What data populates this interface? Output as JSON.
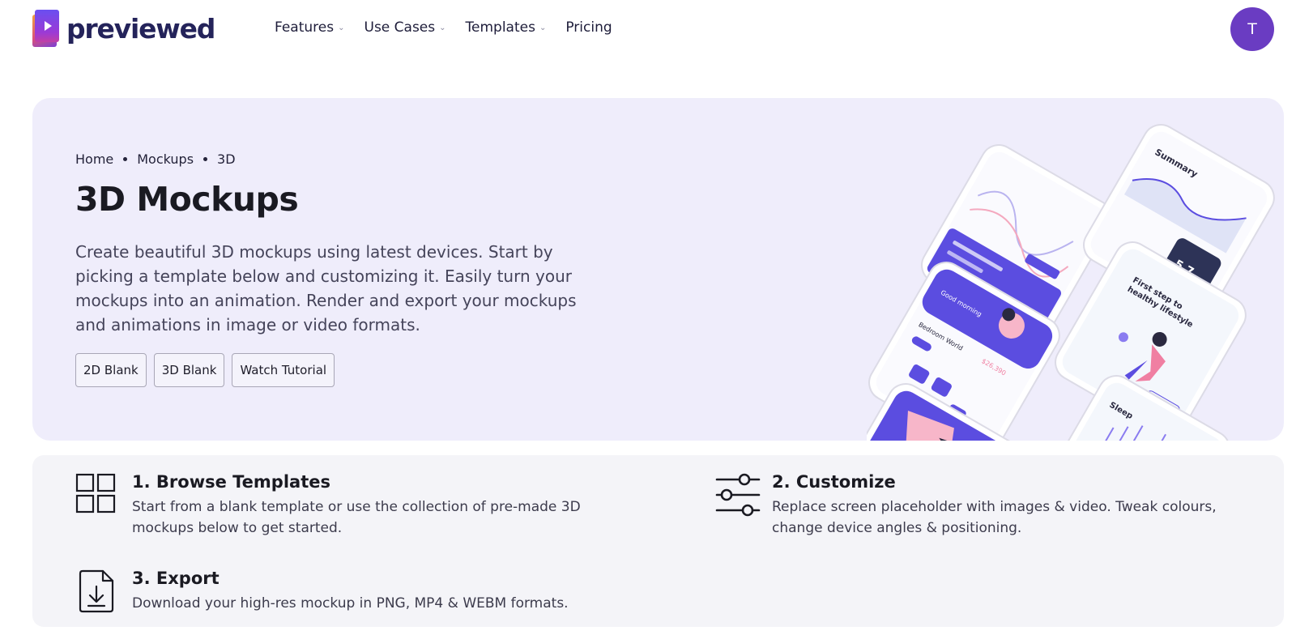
{
  "nav": {
    "logo_text": "previewed",
    "menu": [
      {
        "label": "Features",
        "has_dropdown": true
      },
      {
        "label": "Use Cases",
        "has_dropdown": true
      },
      {
        "label": "Templates",
        "has_dropdown": true
      },
      {
        "label": "Pricing",
        "has_dropdown": false
      }
    ],
    "avatar_initial": "T"
  },
  "hero": {
    "breadcrumb": [
      "Home",
      "Mockups",
      "3D"
    ],
    "title": "3D Mockups",
    "description": "Create beautiful 3D mockups using latest devices. Start by picking a template below and customizing it. Easily turn your mockups into an animation. Render and export your mockups and animations in image or video formats.",
    "buttons": [
      "2D Blank",
      "3D Blank",
      "Watch Tutorial"
    ],
    "art_texts": {
      "summary": "Summary",
      "stat": "5.7",
      "lifestyle1": "First step to",
      "lifestyle2": "healthy lifestyle",
      "sleep": "Sleep",
      "greeting": "Good morning",
      "bedroom": "Bedroom World",
      "money": "$26,390"
    }
  },
  "steps": [
    {
      "title": "1. Browse Templates",
      "description": "Start from a blank template or use the collection of pre-made 3D mockups below to get started.",
      "icon": "grid-icon"
    },
    {
      "title": "2. Customize",
      "description": "Replace screen placeholder with images & video. Tweak colours, change device angles & positioning.",
      "icon": "sliders-icon"
    },
    {
      "title": "3. Export",
      "description": "Download your high-res mockup in PNG, MP4 & WEBM formats.",
      "icon": "download-file-icon"
    }
  ],
  "colors": {
    "accent": "#5b4de0",
    "avatar": "#6a3cc2",
    "hero_bg": "#efedfb",
    "steps_bg": "#f4f4f8"
  }
}
